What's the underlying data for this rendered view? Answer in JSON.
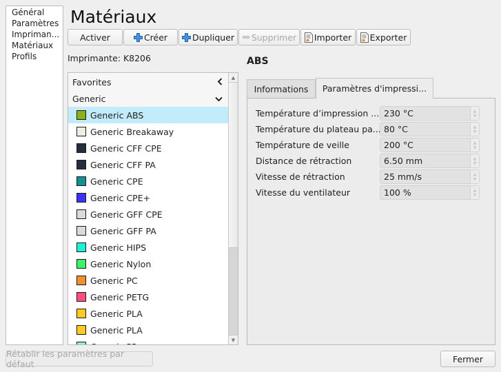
{
  "nav": {
    "items": [
      {
        "label": "Général"
      },
      {
        "label": "Paramètres"
      },
      {
        "label": "Impriman..."
      },
      {
        "label": "Matériaux"
      },
      {
        "label": "Profils"
      }
    ]
  },
  "page": {
    "title": "Matériaux",
    "printer_label": "Imprimante: K8206"
  },
  "toolbar": {
    "activate": "Activer",
    "create": "Créer",
    "duplicate": "Dupliquer",
    "remove": "Supprimer",
    "import": "Importer",
    "export": "Exporter",
    "icons": {
      "create": "plus-icon",
      "duplicate": "plus-icon",
      "remove": "minus-icon",
      "import": "document-icon",
      "export": "document-icon"
    }
  },
  "materials": {
    "sections": [
      {
        "label": "Favorites",
        "state": "collapsed",
        "icon": "chevron-left-icon"
      },
      {
        "label": "Generic",
        "state": "expanded",
        "icon": "chevron-down-icon"
      }
    ],
    "items": [
      {
        "label": "Generic ABS",
        "color": "#8cb219",
        "selected": true
      },
      {
        "label": "Generic Breakaway",
        "color": "#f2ede4",
        "selected": false
      },
      {
        "label": "Generic CFF CPE",
        "color": "#242e3c",
        "selected": false
      },
      {
        "label": "Generic CFF PA",
        "color": "#242e3c",
        "selected": false
      },
      {
        "label": "Generic CPE",
        "color": "#158e94",
        "selected": false
      },
      {
        "label": "Generic CPE+",
        "color": "#3a33f5",
        "selected": false
      },
      {
        "label": "Generic GFF CPE",
        "color": "#d8dadd",
        "selected": false
      },
      {
        "label": "Generic GFF PA",
        "color": "#d8dadd",
        "selected": false
      },
      {
        "label": "Generic HIPS",
        "color": "#1ef0d8",
        "selected": false
      },
      {
        "label": "Generic Nylon",
        "color": "#3df266",
        "selected": false
      },
      {
        "label": "Generic PC",
        "color": "#f29030",
        "selected": false
      },
      {
        "label": "Generic PETG",
        "color": "#ff4f7e",
        "selected": false
      },
      {
        "label": "Generic PLA",
        "color": "#ffc924",
        "selected": false
      },
      {
        "label": "Generic PLA",
        "color": "#ffc924",
        "selected": false
      },
      {
        "label": "Generic PP",
        "color": "#8ef2d8",
        "selected": false
      }
    ]
  },
  "details": {
    "material_name": "ABS",
    "tabs": [
      {
        "label": "Informations",
        "active": false
      },
      {
        "label": "Paramètres d'impressi...",
        "active": true
      }
    ],
    "properties": [
      {
        "label": "Température d’impression ...",
        "value": "230 °C"
      },
      {
        "label": "Température du plateau pa...",
        "value": "80 °C"
      },
      {
        "label": "Température de veille",
        "value": "200 °C"
      },
      {
        "label": "Distance de rétraction",
        "value": "6.50 mm"
      },
      {
        "label": "Vitesse de rétraction",
        "value": "25 mm/s"
      },
      {
        "label": "Vitesse du ventilateur",
        "value": "100 %"
      }
    ]
  },
  "footer": {
    "reset": "Rétablir les paramètres par défaut",
    "close": "Fermer"
  }
}
